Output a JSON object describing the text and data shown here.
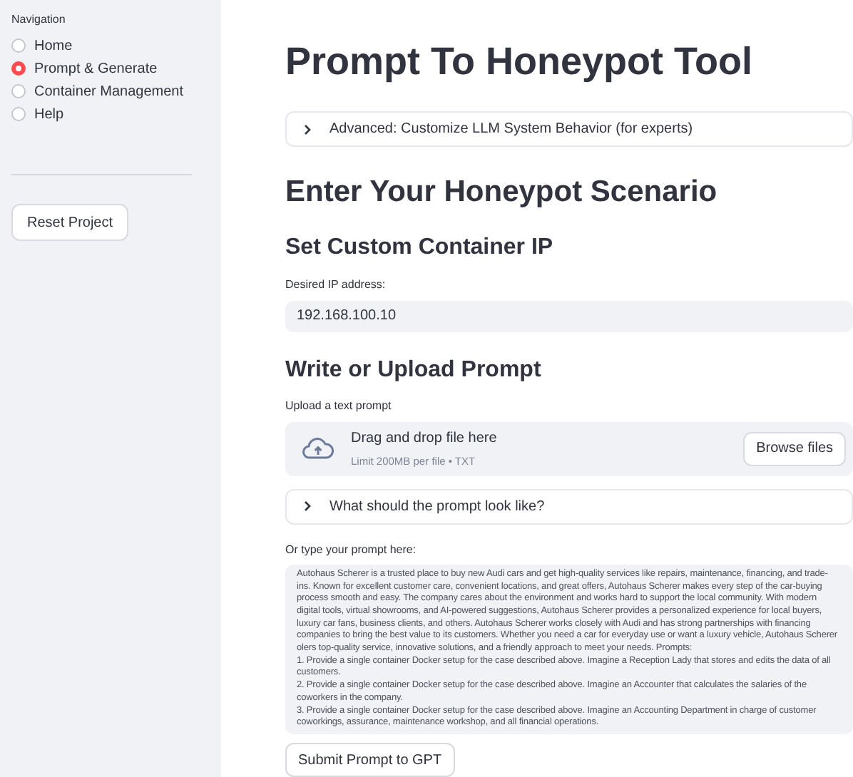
{
  "sidebar": {
    "nav_label": "Navigation",
    "items": [
      {
        "label": "Home",
        "selected": false
      },
      {
        "label": "Prompt & Generate",
        "selected": true
      },
      {
        "label": "Container Management",
        "selected": false
      },
      {
        "label": "Help",
        "selected": false
      }
    ],
    "reset_button": "Reset Project"
  },
  "main": {
    "title": "Prompt To Honeypot Tool",
    "advanced_expander": {
      "label": "Advanced: Customize LLM System Behavior (for experts)",
      "expanded": false
    },
    "scenario_heading": "Enter Your Honeypot Scenario",
    "ip_heading": "Set Custom Container IP",
    "ip_field": {
      "label": "Desired IP address:",
      "value": "192.168.100.10"
    },
    "prompt_heading": "Write or Upload Prompt",
    "uploader": {
      "label": "Upload a text prompt",
      "title": "Drag and drop file here",
      "hint": "Limit 200MB per file • TXT",
      "button": "Browse files"
    },
    "example_expander": {
      "label": "What should the prompt look like?",
      "expanded": false
    },
    "prompt_field": {
      "label": "Or type your prompt here:",
      "value": "Autohaus Scherer is a trusted place to buy new Audi cars and get high-quality services like repairs, maintenance, financing, and trade-ins. Known for excellent customer care, convenient locations, and great offers, Autohaus Scherer makes every step of the car-buying process smooth and easy. The company cares about the environment and works hard to support the local community. With modern digital tools, virtual showrooms, and AI-powered suggestions, Autohaus Scherer provides a personalized experience for local buyers, luxury car fans, business clients, and others. Autohaus Scherer works closely with Audi and has strong partnerships with financing companies to bring the best value to its customers. Whether you need a car for everyday use or want a luxury vehicle, Autohaus Scherer olers top-quality service, innovative solutions, and a friendly approach to meet your needs. Prompts:\n1. Provide a single container Docker setup for the case described above. Imagine a Reception Lady that stores and edits the data of all customers.\n2. Provide a single container Docker setup for the case described above. Imagine an Accounter that calculates the salaries of the coworkers in the company.\n3. Provide a single container Docker setup for the case described above. Imagine an Accounting Department in charge of customer coworkings, assurance, maintenance workshop, and all financial operations."
    },
    "submit_button": "Submit Prompt to GPT"
  }
}
